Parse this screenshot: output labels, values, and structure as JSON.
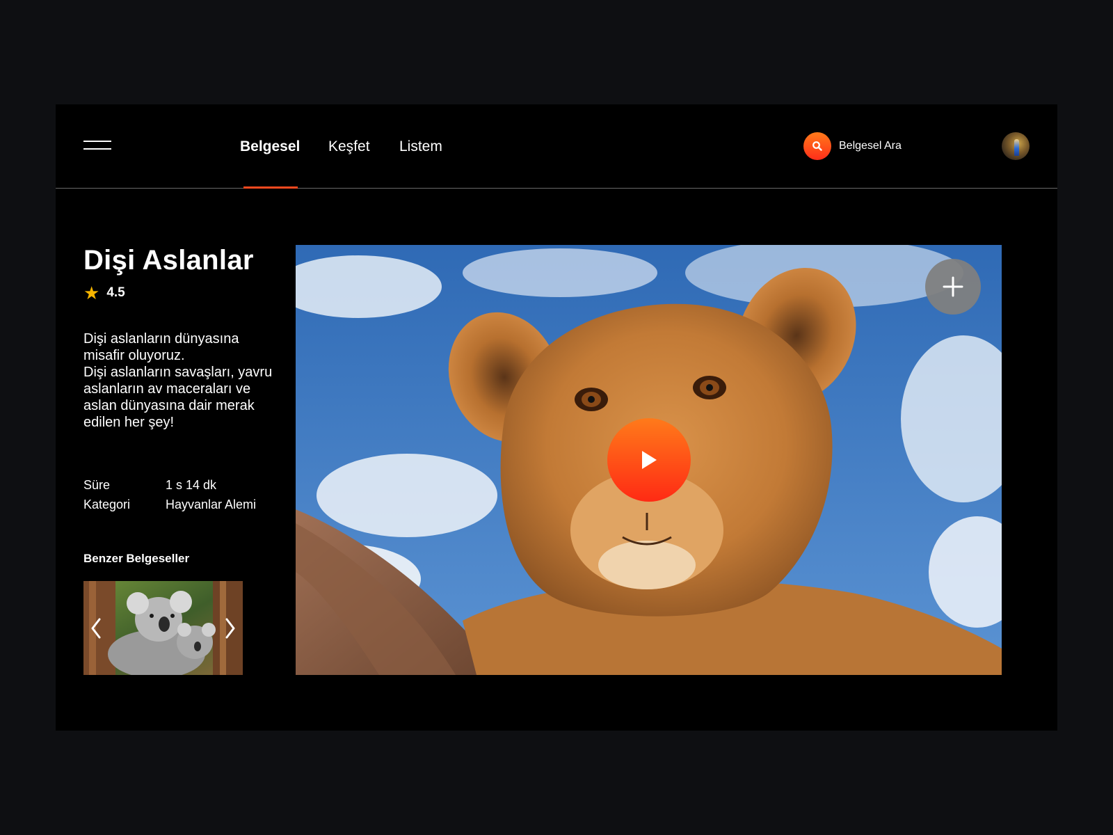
{
  "header": {
    "menu_icon": "hamburger-icon",
    "nav": [
      {
        "label": "Belgesel",
        "active": true
      },
      {
        "label": "Keşfet",
        "active": false
      },
      {
        "label": "Listem",
        "active": false
      }
    ],
    "search": {
      "icon": "search-icon",
      "label": "Belgesel Ara"
    },
    "avatar_icon": "user-avatar"
  },
  "detail": {
    "title": "Dişi Aslanlar",
    "rating": "4.5",
    "rating_icon": "star-icon",
    "description": [
      "Dişi aslanların dünyasına misafir oluyoruz.",
      "Dişi aslanların savaşları, yavru aslanların av maceraları ve aslan dünyasına dair merak edilen her şey!"
    ],
    "meta": [
      {
        "key": "Süre",
        "value": "1 s 14 dk"
      },
      {
        "key": "Kategori",
        "value": "Hayvanlar Alemi"
      }
    ]
  },
  "similar": {
    "title": "Benzer Belgeseller",
    "prev_icon": "chevron-left-icon",
    "next_icon": "chevron-right-icon"
  },
  "video": {
    "add_icon": "plus-icon",
    "play_icon": "play-icon"
  },
  "colors": {
    "accent": "#ff4a1f",
    "accent_gradient_top": "#ff7a1a",
    "star": "#f7b500",
    "frame_bg": "#000000",
    "page_bg": "#0e0f12"
  }
}
